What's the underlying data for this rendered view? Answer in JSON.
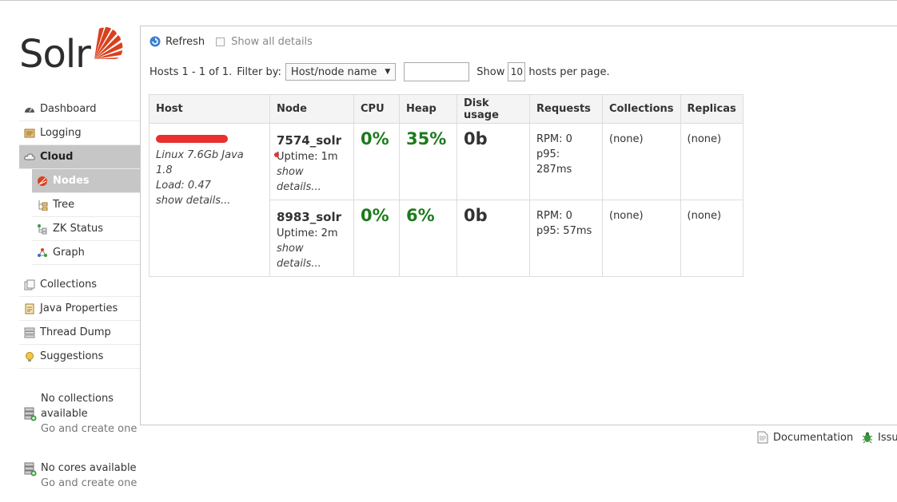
{
  "app": {
    "logo_text": "Solr"
  },
  "nav": {
    "dashboard": "Dashboard",
    "logging": "Logging",
    "cloud": "Cloud",
    "nodes": "Nodes",
    "tree": "Tree",
    "zk_status": "ZK Status",
    "graph": "Graph",
    "collections": "Collections",
    "java_properties": "Java Properties",
    "thread_dump": "Thread Dump",
    "suggestions": "Suggestions"
  },
  "side_notes": {
    "collections_title": "No collections available",
    "collections_link": "Go and create one",
    "cores_title": "No cores available",
    "cores_link": "Go and create one"
  },
  "toolbar": {
    "refresh_label": "Refresh",
    "show_all_label": "Show all details"
  },
  "filter": {
    "hosts_count": "Hosts 1 - 1 of 1.",
    "filter_by_label": "Filter by:",
    "filter_by_selected": "Host/node name",
    "filter_value": "",
    "show_label": "Show",
    "per_page_value": "10",
    "per_page_suffix": "hosts per page."
  },
  "table": {
    "headers": [
      "Host",
      "Node",
      "CPU",
      "Heap",
      "Disk usage",
      "Requests",
      "Collections",
      "Replicas"
    ],
    "host": {
      "info": "Linux 7.6Gb Java 1.8",
      "load": "Load: 0.47",
      "show_details": "show details..."
    },
    "rows": [
      {
        "node": "7574_solr",
        "uptime": "Uptime: 1m",
        "show_details": "show details...",
        "cpu": "0%",
        "heap": "35%",
        "disk": "0b",
        "rpm": "RPM: 0",
        "p95": "p95: 287ms",
        "collections": "(none)",
        "replicas": "(none)"
      },
      {
        "node": "8983_solr",
        "uptime": "Uptime: 2m",
        "show_details": "show details...",
        "cpu": "0%",
        "heap": "6%",
        "disk": "0b",
        "rpm": "RPM: 0",
        "p95": "p95: 57ms",
        "collections": "(none)",
        "replicas": "(none)"
      }
    ]
  },
  "footer": {
    "documentation": "Documentation",
    "issues": "Issu"
  },
  "colors": {
    "accent": "#d9411e",
    "green": "#1d7a1d",
    "active_nav": "#c6c6c6"
  }
}
